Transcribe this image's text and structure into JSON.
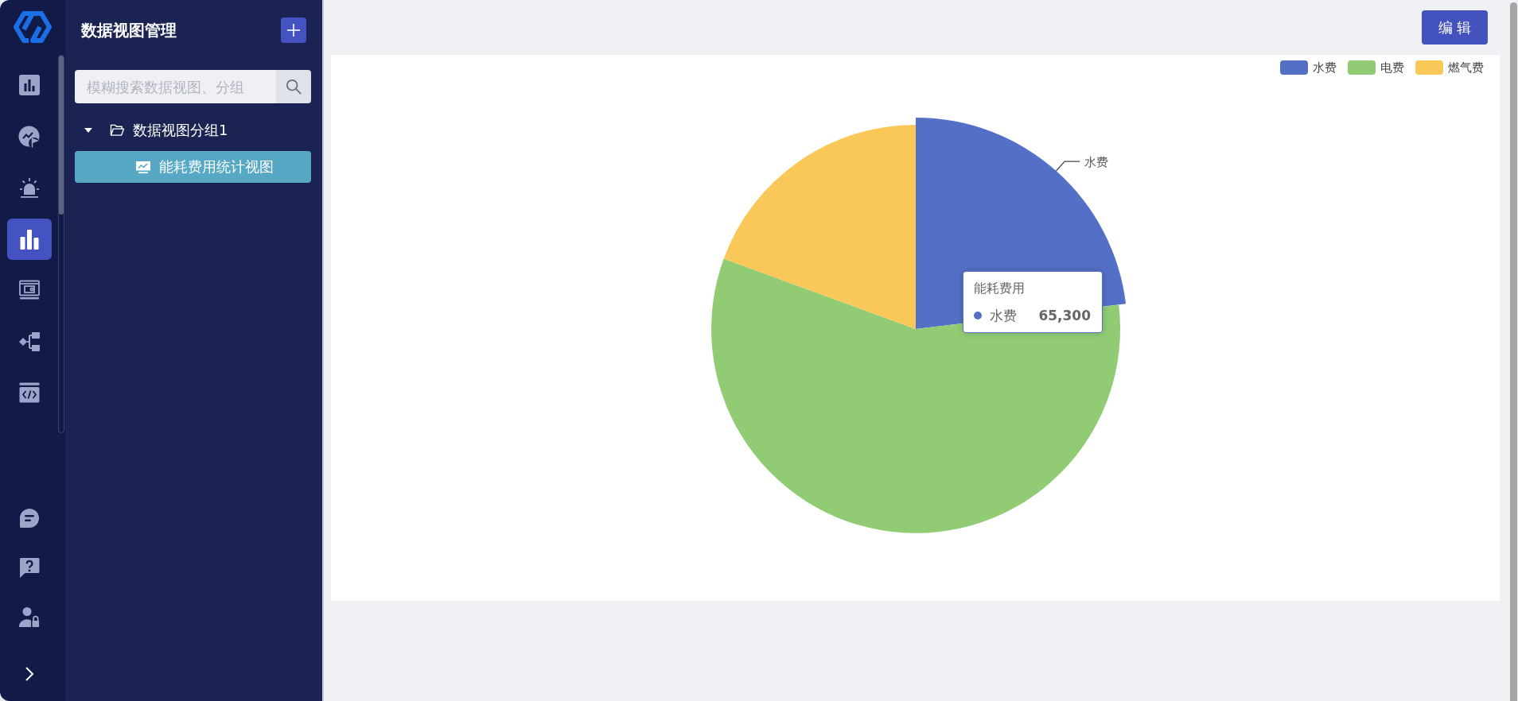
{
  "rail": {
    "items": [
      {
        "selected": false
      },
      {
        "selected": false
      },
      {
        "selected": false
      },
      {
        "selected": true
      },
      {
        "selected": false
      },
      {
        "selected": false
      },
      {
        "selected": false
      }
    ]
  },
  "sidebar": {
    "title": "数据视图管理",
    "search": {
      "placeholder": "模糊搜索数据视图、分组"
    },
    "tree": [
      {
        "label": "数据视图分组1",
        "expanded": true,
        "selected": false,
        "children": [
          {
            "label": "能耗费用统计视图",
            "selected": true
          }
        ]
      }
    ]
  },
  "toolbar": {
    "buttons": [
      "编 辑"
    ]
  },
  "chart": {
    "legend": [
      {
        "label": "水费",
        "color": "#5470c6"
      },
      {
        "label": "电费",
        "color": "#91cc75"
      },
      {
        "label": "燃气费",
        "color": "#fac858"
      }
    ],
    "slices": [
      {
        "color": "#5470c6",
        "highlighted": true,
        "label": "水费"
      },
      {
        "color": "#91cc75",
        "highlighted": false
      },
      {
        "color": "#fac858",
        "highlighted": false
      }
    ],
    "tooltip": {
      "title": "能耗费用",
      "color": "#5470c6",
      "name": "水费",
      "value": "65,300"
    }
  }
}
